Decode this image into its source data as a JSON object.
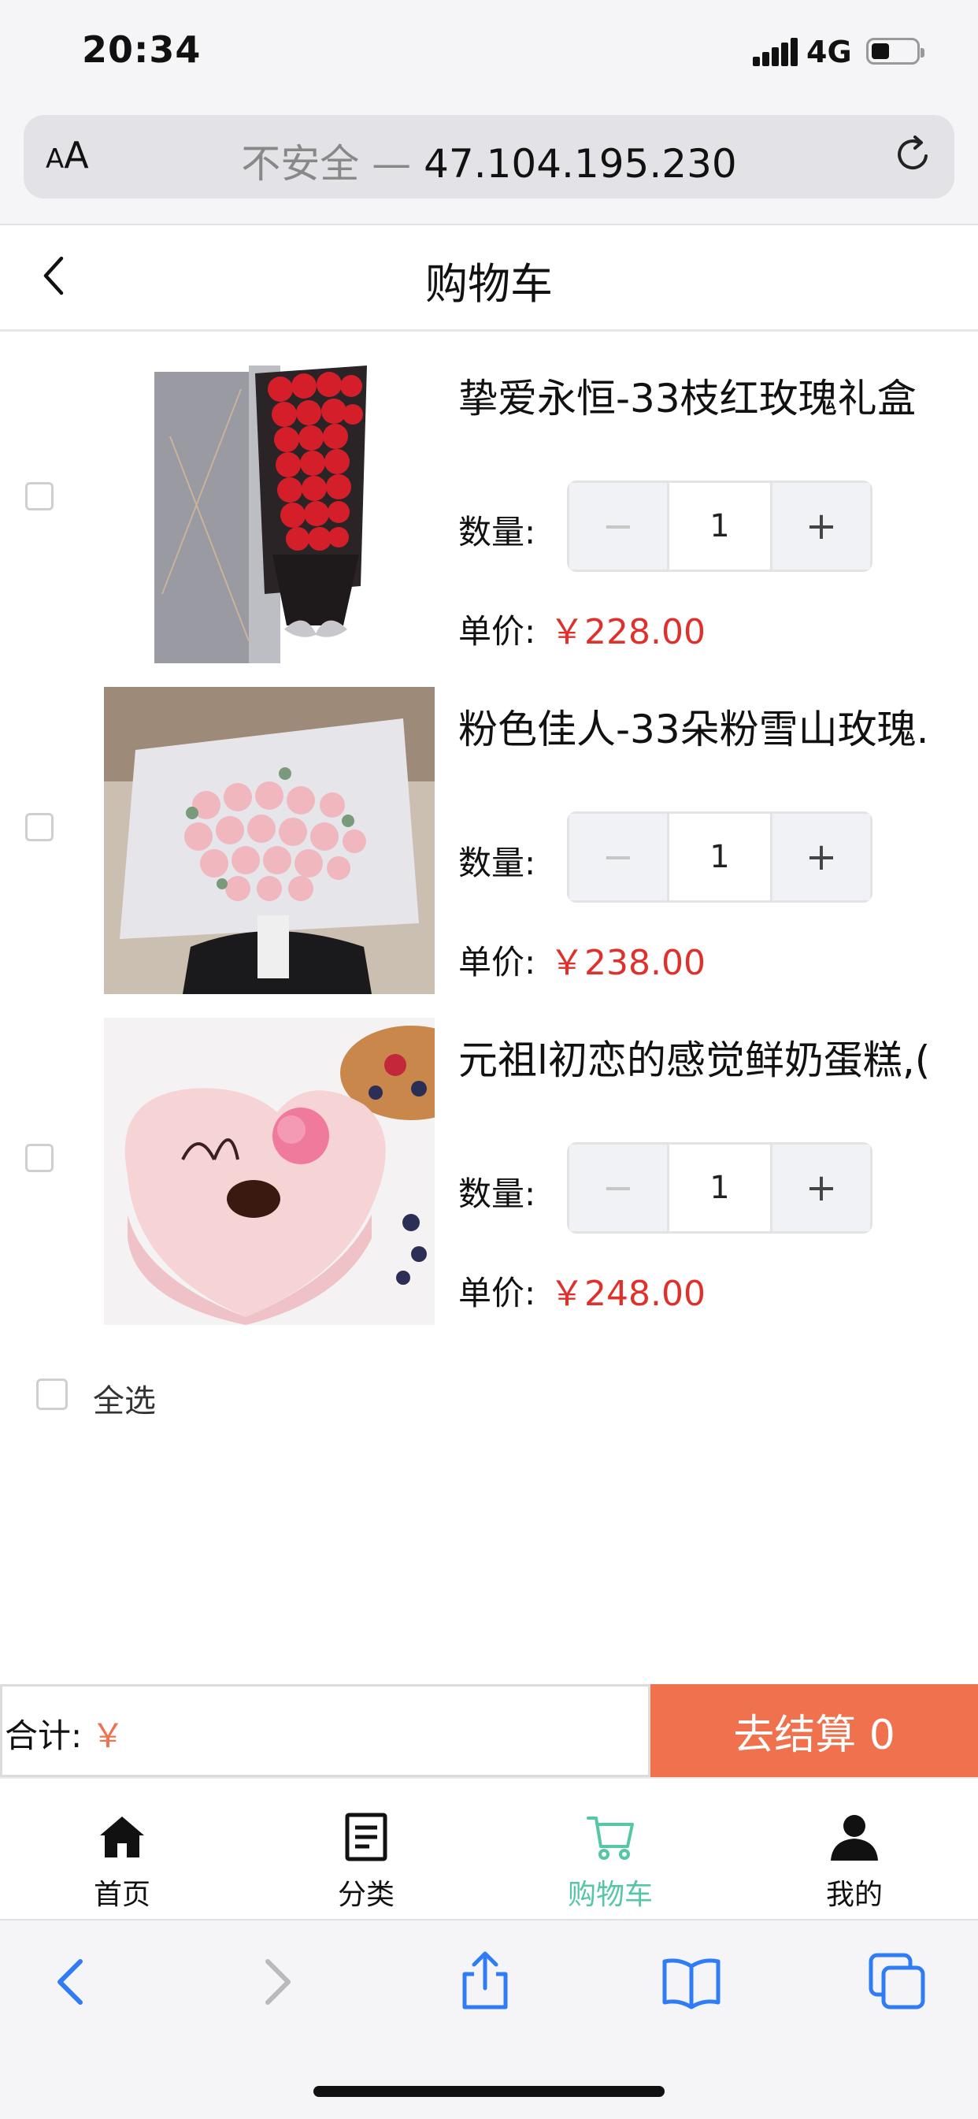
{
  "status_bar": {
    "time": "20:34",
    "network": "4G"
  },
  "url_bar": {
    "text_size": "AA",
    "insecure_label": "不安全 —",
    "address": "47.104.195.230"
  },
  "header": {
    "title": "购物车"
  },
  "cart": {
    "items": [
      {
        "name": "挚爱永恒-33枝红玫瑰礼盒",
        "qty_label": "数量:",
        "qty": "1",
        "price_label": "单价:",
        "price": "￥228.00"
      },
      {
        "name": "粉色佳人-33朵粉雪山玫瑰.",
        "qty_label": "数量:",
        "qty": "1",
        "price_label": "单价:",
        "price": "￥238.00"
      },
      {
        "name": "元祖l初恋的感觉鲜奶蛋糕,(",
        "qty_label": "数量:",
        "qty": "1",
        "price_label": "单价:",
        "price": "￥248.00"
      }
    ],
    "select_all": "全选"
  },
  "footer": {
    "total_label": "合计:",
    "total_value": "￥",
    "checkout_label": "去结算 0"
  },
  "tabs": [
    {
      "label": "首页",
      "icon": "home-icon"
    },
    {
      "label": "分类",
      "icon": "category-icon"
    },
    {
      "label": "购物车",
      "icon": "cart-icon",
      "active": true
    },
    {
      "label": "我的",
      "icon": "user-icon"
    }
  ],
  "colors": {
    "accent": "#f0714e",
    "price": "#e0302c",
    "tab_active": "#56c7a5",
    "safari_blue": "#2f7cf6"
  }
}
